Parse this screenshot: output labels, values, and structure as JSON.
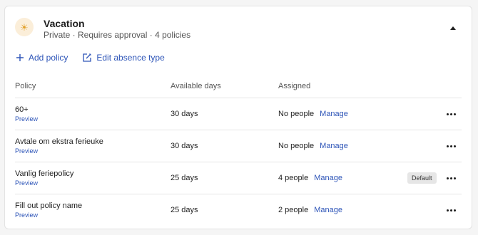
{
  "absence_type": {
    "icon": "sun-icon",
    "title": "Vacation",
    "subtitle": "Private · Requires approval · 4 policies",
    "icon_bg": "#fbeed9",
    "icon_color": "#e2a12b"
  },
  "actions": {
    "add_policy": "Add policy",
    "edit_absence_type": "Edit absence type"
  },
  "table": {
    "headers": {
      "policy": "Policy",
      "available_days": "Available days",
      "assigned": "Assigned"
    },
    "rows": [
      {
        "name": "60+",
        "preview": "Preview",
        "days": "30 days",
        "assigned": "No people",
        "manage": "Manage",
        "badge": ""
      },
      {
        "name": "Avtale om ekstra ferieuke",
        "preview": "Preview",
        "days": "30 days",
        "assigned": "No people",
        "manage": "Manage",
        "badge": ""
      },
      {
        "name": "Vanlig feriepolicy",
        "preview": "Preview",
        "days": "25 days",
        "assigned": "4 people",
        "manage": "Manage",
        "badge": "Default"
      },
      {
        "name": "Fill out policy name",
        "preview": "Preview",
        "days": "25 days",
        "assigned": "2 people",
        "manage": "Manage",
        "badge": ""
      }
    ]
  },
  "colors": {
    "link": "#2e55b8",
    "text": "#1f1f1f",
    "muted": "#555555",
    "badge_bg": "#e6e6e6"
  }
}
